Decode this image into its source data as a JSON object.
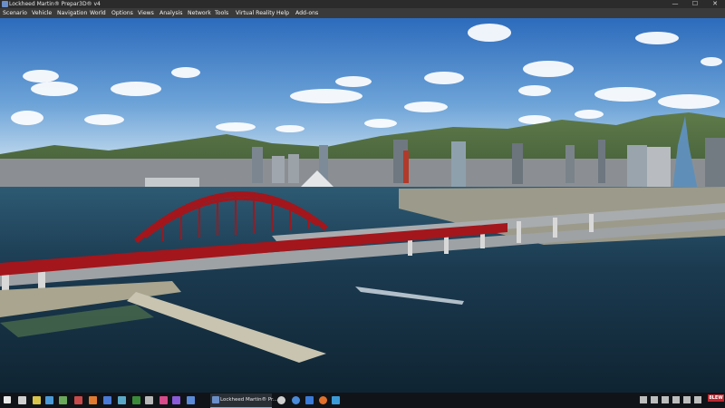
{
  "window": {
    "title": "Lockheed Martin® Prepar3D® v4",
    "minimize_glyph": "—",
    "maximize_glyph": "☐",
    "close_glyph": "✕"
  },
  "menu": {
    "items": [
      {
        "label": "Scenario"
      },
      {
        "label": "Vehicle"
      },
      {
        "label": "Navigation"
      },
      {
        "label": "World"
      },
      {
        "label": "Options"
      },
      {
        "label": "Views"
      },
      {
        "label": "Analysis"
      },
      {
        "label": "Network"
      },
      {
        "label": "Tools"
      },
      {
        "label": "Virtual Reality"
      },
      {
        "label": "Help"
      },
      {
        "label": "Add-ons"
      }
    ]
  },
  "scene": {
    "sky_top": "#2f6fbf",
    "sky_horizon": "#bcd6ec",
    "water": "#1d3a4f",
    "bridge_color": "#a3161c"
  },
  "taskbar": {
    "active_window_label": "Lockheed Martin® Pr...",
    "pinned_icons": [
      "windows-start-icon",
      "search-icon",
      "app-icon-1",
      "app-icon-2",
      "app-icon-3",
      "app-icon-4",
      "app-icon-5",
      "app-icon-6",
      "app-icon-7",
      "app-icon-8",
      "app-icon-9",
      "app-icon-10",
      "app-icon-11",
      "app-icon-12"
    ],
    "tray_badge": "8LEW"
  }
}
